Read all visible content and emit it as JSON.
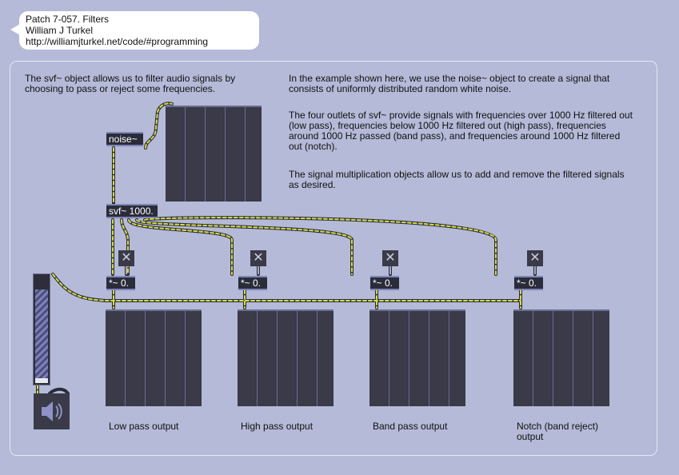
{
  "header_comment": {
    "line1": "Patch 7-057. Filters",
    "line2": "William J Turkel",
    "line3": "http://williamjturkel.net/code/#programming"
  },
  "notes": {
    "intro": "The svf~ object allows us to filter audio signals by choosing to pass or reject some frequencies.",
    "noise_note": "In the example shown here, we use the noise~ object to create a signal that consists of uniformly distributed random white noise.",
    "outlets_note": "The four outlets of svf~ provide signals with frequencies over 1000 Hz filtered out (low pass), frequencies below 1000 Hz filtered out (high pass), frequencies around 1000 Hz passed (band pass), and frequencies around 1000 Hz filtered out (notch).",
    "mult_note": "The signal multiplication objects allow us to add and remove the filtered signals as desired."
  },
  "objects": {
    "noise": "noise~",
    "svf": "svf~ 1000.",
    "mult_low": "*~ 0.",
    "mult_high": "*~ 0.",
    "mult_band": "*~ 0.",
    "mult_notch": "*~ 0."
  },
  "toggles": {
    "low": "✕",
    "high": "✕",
    "band": "✕",
    "notch": "✕"
  },
  "gain_slider": {
    "level": 0.92
  },
  "outputs": {
    "low": "Low pass output",
    "high": "High pass output",
    "band": "Band pass output",
    "notch": "Notch (band reject) output"
  },
  "icons": {
    "speaker": "speaker-icon",
    "toggle": "close-icon"
  },
  "colors": {
    "background": "#b4bad7",
    "object": "#2b2c3a",
    "cord": "#d6dc44"
  }
}
